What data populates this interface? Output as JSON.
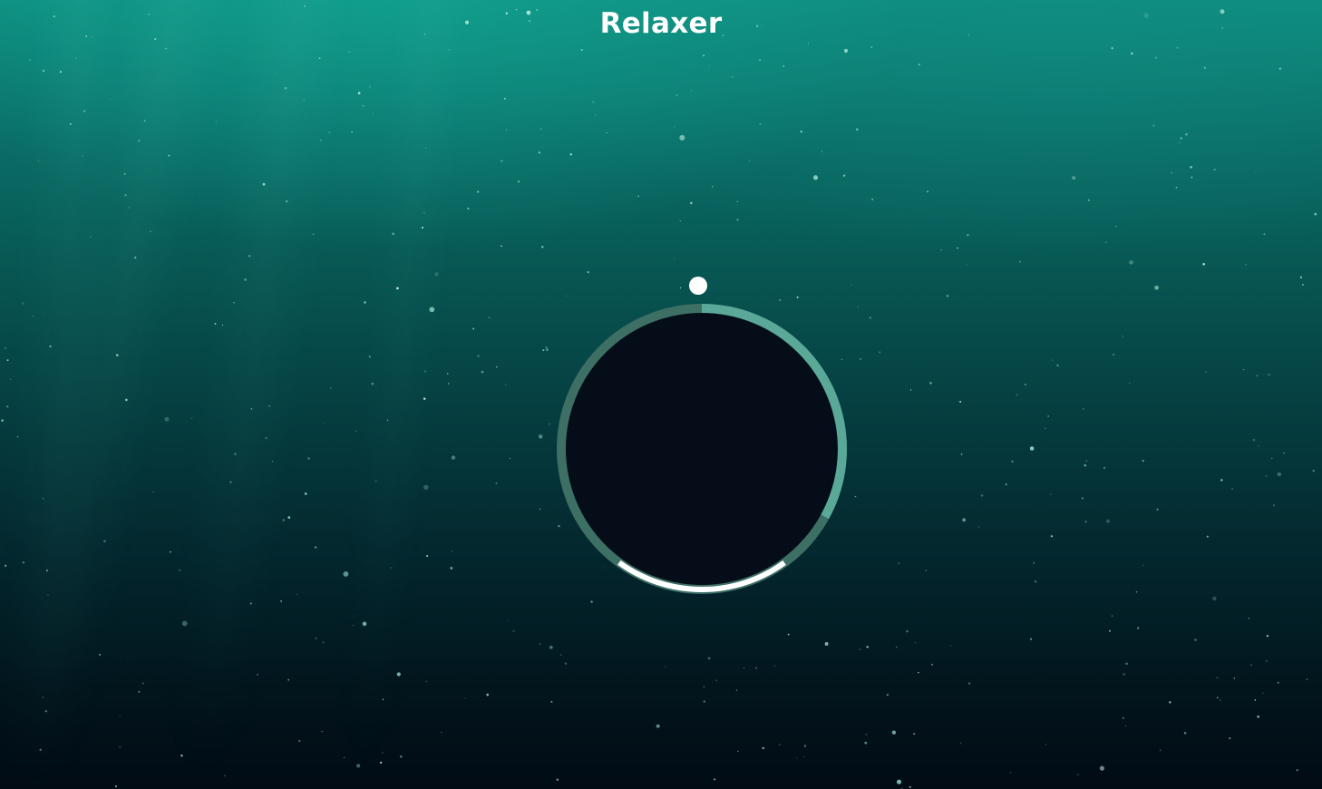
{
  "app": {
    "title": "Relaxer"
  },
  "timer": {
    "progress": 0.33,
    "colors": {
      "inner": "#040d18",
      "track": "#3d6f65",
      "progress_arc": "#5aa898",
      "breath_arc": "#ffffff",
      "pointer": "#ffffff"
    }
  },
  "background": {
    "theme": "underwater",
    "top_color": "#0e8f80",
    "bottom_color": "#010b14"
  }
}
